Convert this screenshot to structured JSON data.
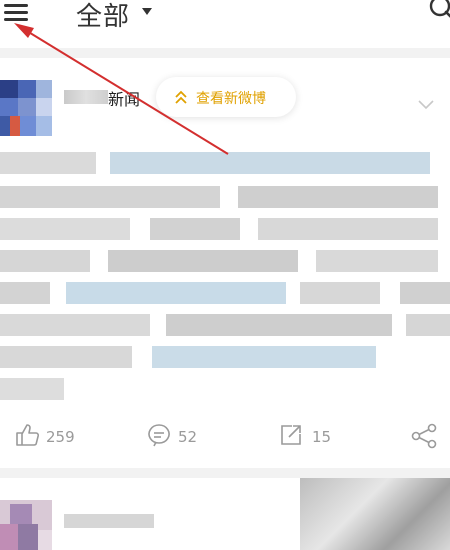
{
  "header": {
    "title": "全部",
    "menu_icon": "menu-icon",
    "dropdown_icon": "caret-down-icon",
    "search_icon": "search-icon"
  },
  "post": {
    "author_suffix": "新闻",
    "new_posts_pill": "查看新微博",
    "more_icon": "chevron-down-icon",
    "accent_color": "#e0a100",
    "actions": {
      "likes": "259",
      "comments": "52",
      "reposts": "15"
    }
  },
  "annotation": {
    "color": "#d32f2f",
    "arrow_icon": "annotation-arrow"
  }
}
